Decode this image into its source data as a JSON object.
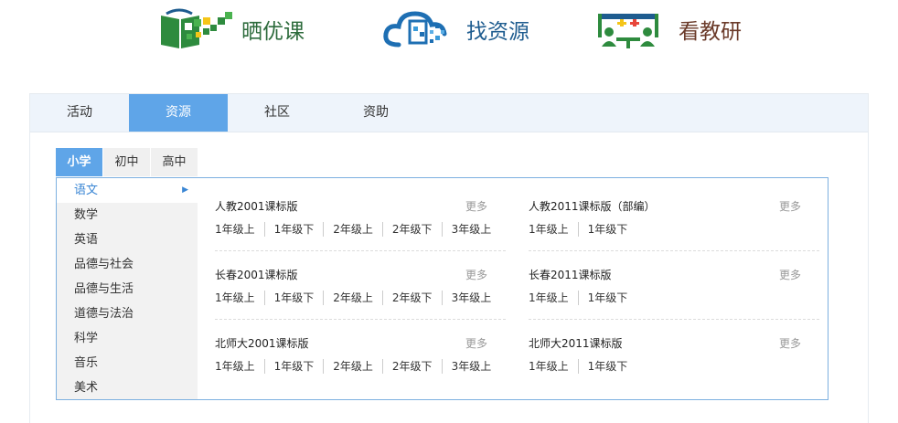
{
  "brands": [
    {
      "label": "晒优课",
      "icon": "sun-class-logo-icon",
      "color": "#2d6b3c"
    },
    {
      "label": "找资源",
      "icon": "cloud-resource-logo-icon",
      "color": "#1e5c8f"
    },
    {
      "label": "看教研",
      "icon": "teaching-research-logo-icon",
      "color": "#6b3b2a"
    }
  ],
  "top_nav": {
    "tabs": [
      "活动",
      "资源",
      "社区",
      "资助"
    ],
    "active": "资源"
  },
  "stage_tabs": {
    "items": [
      "小学",
      "初中",
      "高中"
    ],
    "active": "小学"
  },
  "subjects": {
    "items": [
      "语文",
      "数学",
      "英语",
      "品德与社会",
      "品德与生活",
      "道德与法治",
      "科学",
      "音乐",
      "美术"
    ],
    "active": "语文"
  },
  "editions": [
    {
      "title": "人教2001课标版",
      "more": "更多",
      "grades": [
        "1年级上",
        "1年级下",
        "2年级上",
        "2年级下",
        "3年级上"
      ]
    },
    {
      "title": "人教2011课标版（部编）",
      "more": "更多",
      "grades": [
        "1年级上",
        "1年级下"
      ]
    },
    {
      "title": "长春2001课标版",
      "more": "更多",
      "grades": [
        "1年级上",
        "1年级下",
        "2年级上",
        "2年级下",
        "3年级上"
      ]
    },
    {
      "title": "长春2011课标版",
      "more": "更多",
      "grades": [
        "1年级上",
        "1年级下"
      ]
    },
    {
      "title": "北师大2001课标版",
      "more": "更多",
      "grades": [
        "1年级上",
        "1年级下",
        "2年级上",
        "2年级下",
        "3年级上"
      ]
    },
    {
      "title": "北师大2011课标版",
      "more": "更多",
      "grades": [
        "1年级上",
        "1年级下"
      ]
    }
  ],
  "colors": {
    "accent": "#5fa5e8",
    "nav_bg": "#eef4fb",
    "box_border": "#7db0e0",
    "subject_active": "#3a86d4"
  }
}
